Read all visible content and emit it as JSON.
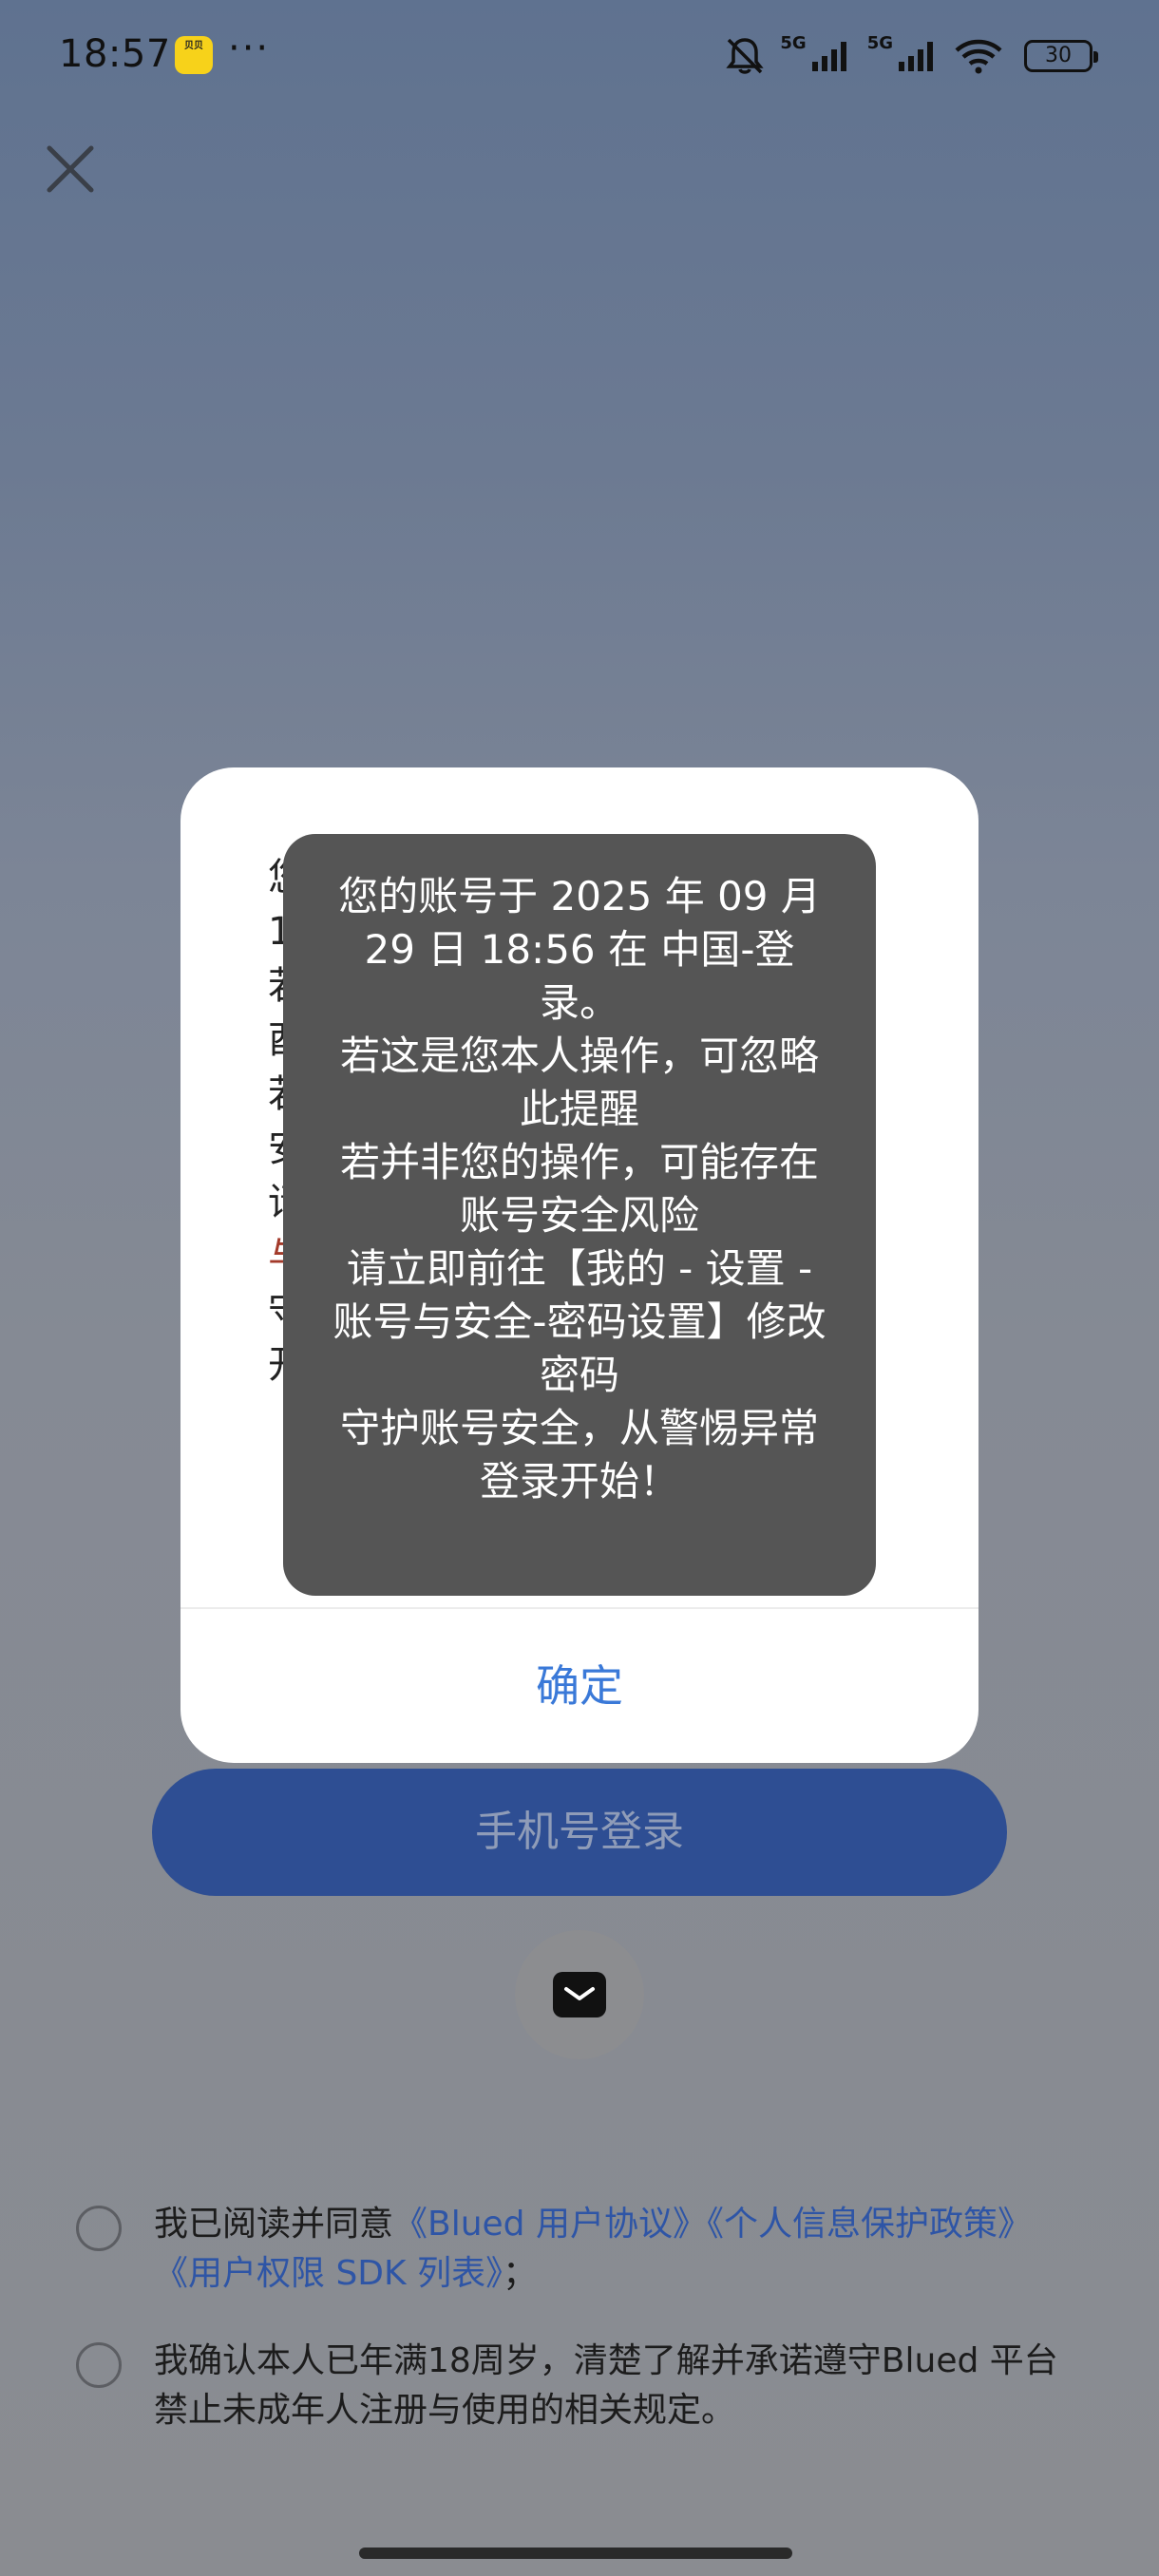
{
  "status_bar": {
    "time": "18:57",
    "app_badge": "贝贝",
    "more": "···",
    "net1": "5G",
    "net2": "5G",
    "battery": "30"
  },
  "dialog": {
    "body_lines": [
      "您",
      "1",
      "若",
      "酉",
      "若",
      "安",
      "请",
      "与",
      "守",
      "开"
    ],
    "confirm_label": "确定"
  },
  "toast": {
    "lines": [
      "您的账号于 2025 年 09 月 29 日 18:56 在 中国-登录。",
      "若这是您本人操作，可忽略此提醒",
      "若并非您的操作，可能存在账号安全风险",
      "请立即前往【我的 - 设置 - 账号与安全-密码设置】修改密码",
      "守护账号安全，从警惕异常登录开始！"
    ]
  },
  "login": {
    "phone_label": "手机号登录"
  },
  "agreements": {
    "row1_prefix": "我已阅读并同意",
    "user_agreement": "《Blued 用户协议》",
    "privacy_policy": "《个人信息保护政策》",
    "sdk_list": "《用户权限 SDK 列表》",
    "row1_suffix": "；",
    "row2_text": "我确认本人已年满18周岁，清楚了解并承诺遵守Blued 平台禁止未成年人注册与使用的相关规定。"
  },
  "colors": {
    "accent": "#3a79d8",
    "button": "#2e4e93",
    "link": "#2e55a6",
    "toast": "#555555"
  }
}
